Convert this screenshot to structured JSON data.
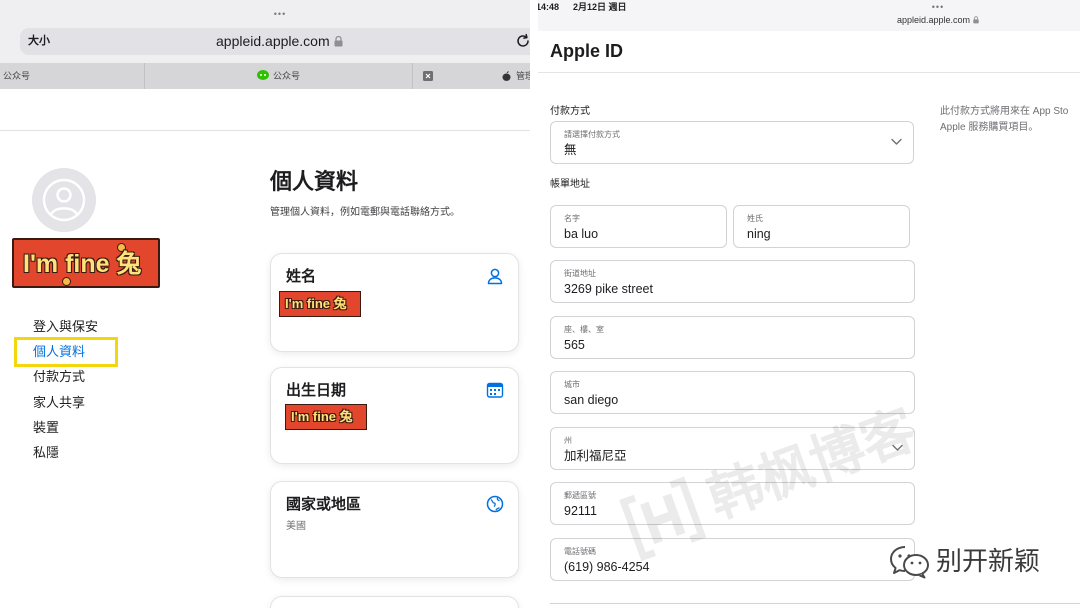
{
  "left": {
    "browser": {
      "dots": "•••",
      "text_size_label": "大小",
      "url": "appleid.apple.com",
      "tabs": [
        {
          "label": "公众号"
        },
        {
          "label": "公众号",
          "icon": "wechat-icon"
        },
        {
          "label": "管理你",
          "icons": [
            "close-tab-icon",
            "apple-logo-icon"
          ]
        }
      ]
    },
    "sidebar": {
      "avatar_icon": "person-avatar-icon",
      "sticker_text": "I'm fine 兔",
      "items": [
        {
          "label": "登入與保安"
        },
        {
          "label": "個人資料",
          "selected": true
        },
        {
          "label": "付款方式"
        },
        {
          "label": "家人共享"
        },
        {
          "label": "裝置"
        },
        {
          "label": "私隱"
        }
      ]
    },
    "main": {
      "title": "個人資料",
      "subtitle": "管理個人資料，例如電郵與電話聯絡方式。",
      "cards": [
        {
          "title": "姓名",
          "icon": "person-icon",
          "sticker_text": "I'm fine 兔"
        },
        {
          "title": "出生日期",
          "icon": "calendar-icon",
          "sticker_text": "I'm fine 兔"
        },
        {
          "title": "國家或地區",
          "icon": "globe-icon",
          "value": "美國"
        }
      ]
    }
  },
  "right": {
    "status": {
      "time": "14:48",
      "date": "2月12日 週日",
      "dots": "•••",
      "url": "appleid.apple.com"
    },
    "header_title": "Apple ID",
    "payment": {
      "section_label": "付款方式",
      "select_label": "請選擇付款方式",
      "select_value": "無",
      "note_line1": "此付款方式將用來在 App Sto",
      "note_line2": "Apple 服務購買項目。"
    },
    "billing": {
      "section_label": "帳單地址",
      "first_name": {
        "label": "名字",
        "value": "ba luo"
      },
      "last_name": {
        "label": "姓氏",
        "value": "ning"
      },
      "street": {
        "label": "街道地址",
        "value": "3269 pike street"
      },
      "unit": {
        "label": "座、樓、室",
        "value": "565"
      },
      "city": {
        "label": "城市",
        "value": "san diego"
      },
      "state": {
        "label": "州",
        "value": "加利福尼亞"
      },
      "zip": {
        "label": "郵遞區號",
        "value": "92111"
      },
      "phone": {
        "label": "電話號碼",
        "value": "(619) 986-4254"
      }
    },
    "watermark_text": "韩枫博客",
    "badge_text": "别开新颖",
    "badge_icon": "wechat-outline-icon"
  },
  "colors": {
    "accent": "#0071e3",
    "highlight_box": "#f4d60c",
    "sticker_red": "#e2462d",
    "sticker_text": "#ffe27a",
    "wechat_green": "#2dc100"
  }
}
